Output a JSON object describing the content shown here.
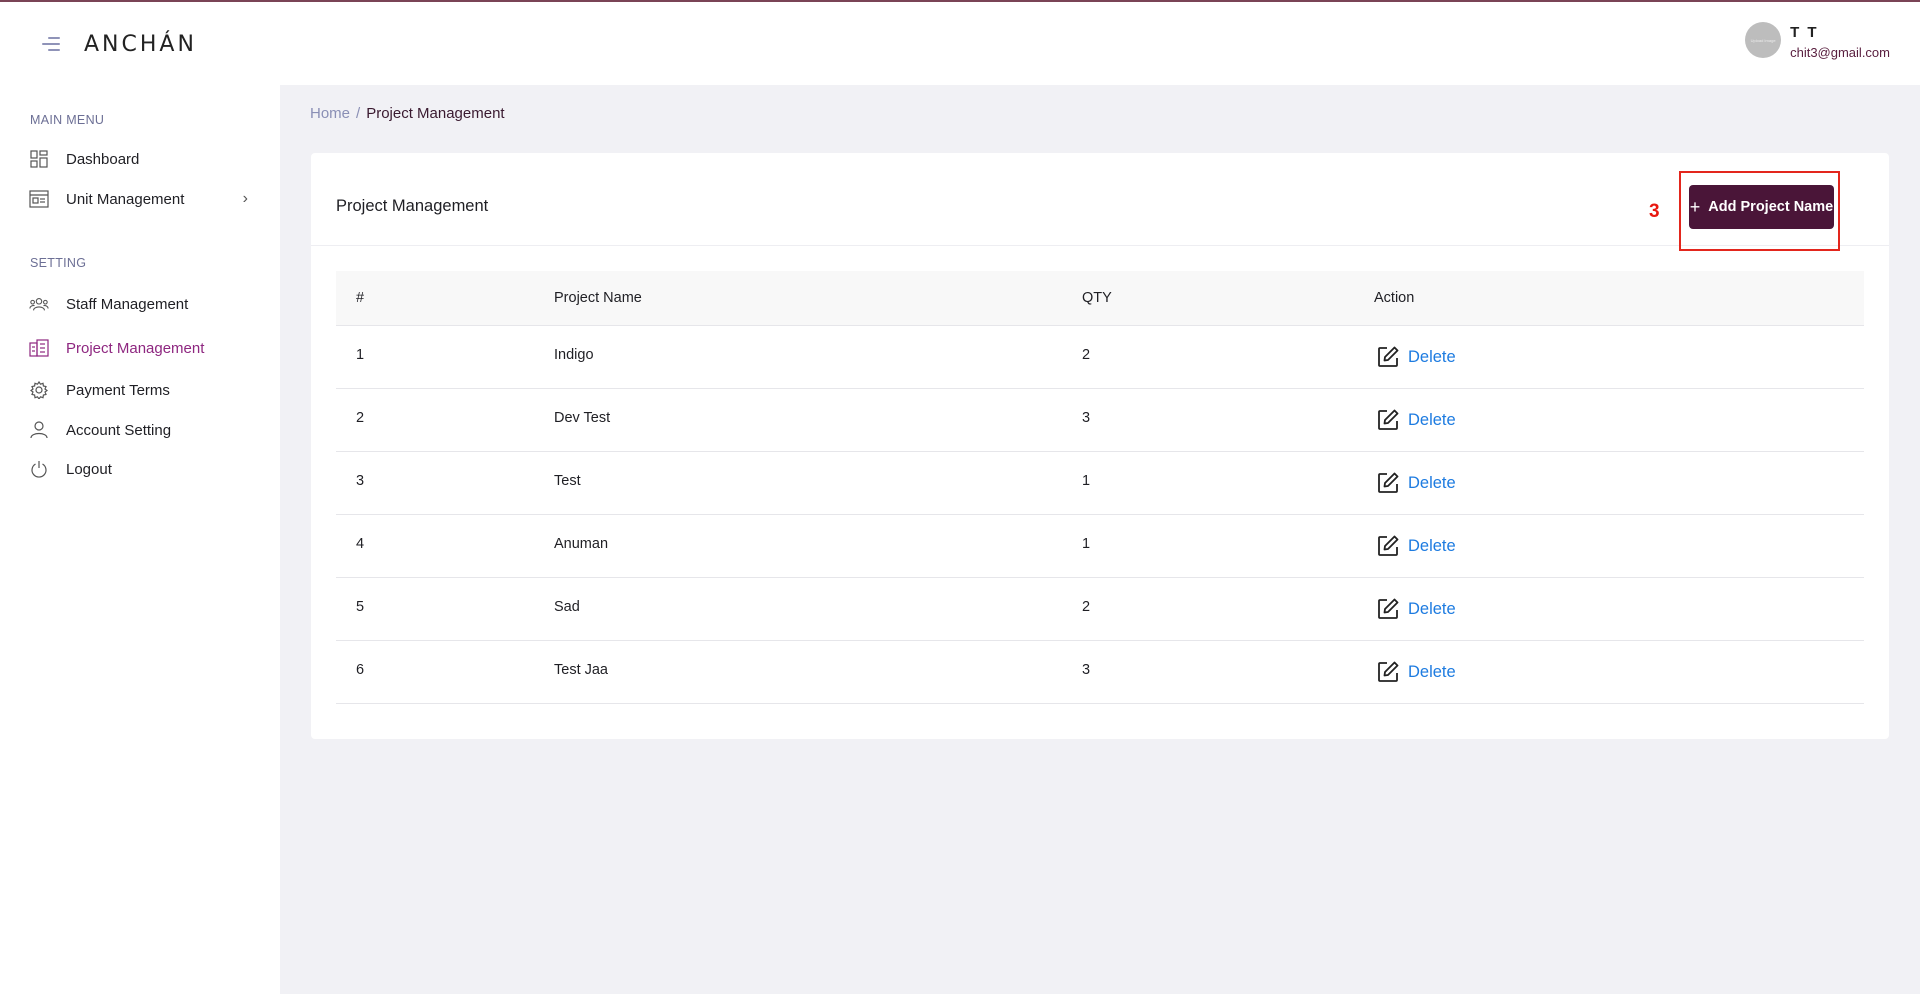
{
  "header": {
    "logo": "ANCHÁN",
    "user_name": "T T",
    "user_email": "chit3@gmail.com",
    "avatar_text": "Upload Image"
  },
  "sidebar": {
    "main_menu_heading": "MAIN MENU",
    "setting_heading": "SETTING",
    "items": [
      {
        "label": "Dashboard",
        "icon": "dashboard-icon"
      },
      {
        "label": "Unit Management",
        "icon": "unit-icon"
      },
      {
        "label": "Staff Management",
        "icon": "staff-icon"
      },
      {
        "label": "Project Management",
        "icon": "project-icon"
      },
      {
        "label": "Payment Terms",
        "icon": "gear-icon"
      },
      {
        "label": "Account Setting",
        "icon": "user-icon"
      },
      {
        "label": "Logout",
        "icon": "power-icon"
      }
    ],
    "active_item": "Project Management"
  },
  "breadcrumb": {
    "home": "Home",
    "separator": "/",
    "current": "Project Management"
  },
  "card": {
    "title": "Project Management",
    "step_number": "3",
    "add_button_label": "Add Project Name"
  },
  "table": {
    "headers": [
      "#",
      "Project Name",
      "QTY",
      "Action"
    ],
    "rows": [
      {
        "num": "1",
        "name": "Indigo",
        "qty": "2"
      },
      {
        "num": "2",
        "name": "Dev Test",
        "qty": "3"
      },
      {
        "num": "3",
        "name": "Test",
        "qty": "1"
      },
      {
        "num": "4",
        "name": "Anuman",
        "qty": "1"
      },
      {
        "num": "5",
        "name": "Sad",
        "qty": "2"
      },
      {
        "num": "6",
        "name": "Test Jaa",
        "qty": "3"
      }
    ],
    "delete_label": "Delete"
  },
  "colors": {
    "primary": "#4a1538",
    "active_menu": "#8e2780",
    "link": "#1d7be0",
    "highlight": "#e3261d"
  }
}
